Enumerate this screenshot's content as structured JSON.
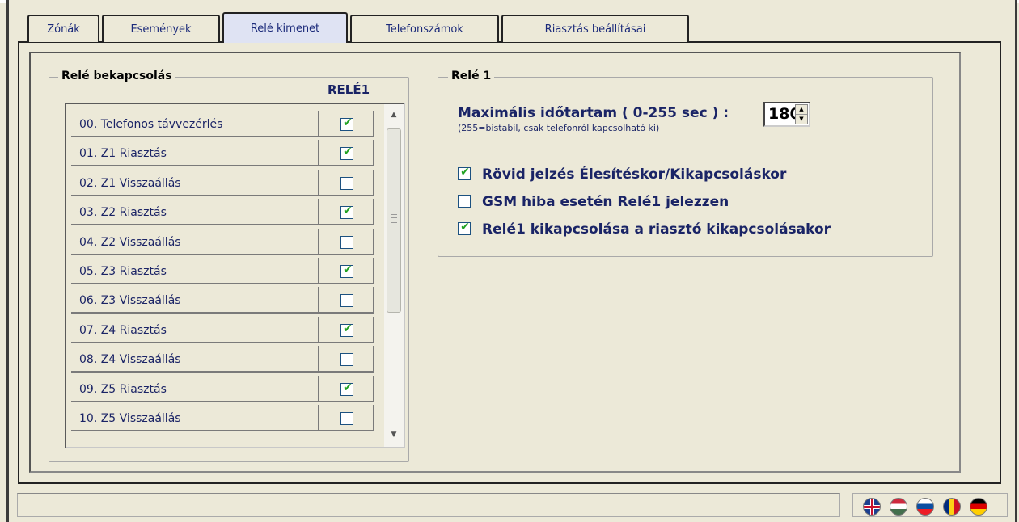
{
  "tabs": [
    {
      "label": "Zónák"
    },
    {
      "label": "Események"
    },
    {
      "label": "Relé kimenet"
    },
    {
      "label": "Telefonszámok"
    },
    {
      "label": "Riasztás beállításai"
    }
  ],
  "active_tab": "Relé kimenet",
  "relay_switch_group": {
    "title": "Relé bekapcsolás",
    "column_header": "RELÉ1",
    "rows": [
      {
        "label": "00. Telefonos távvezérlés",
        "checked": true
      },
      {
        "label": "01. Z1 Riasztás",
        "checked": true
      },
      {
        "label": "02. Z1 Visszaállás",
        "checked": false
      },
      {
        "label": "03. Z2 Riasztás",
        "checked": true
      },
      {
        "label": "04. Z2 Visszaállás",
        "checked": false
      },
      {
        "label": "05. Z3 Riasztás",
        "checked": true
      },
      {
        "label": "06. Z3 Visszaállás",
        "checked": false
      },
      {
        "label": "07. Z4 Riasztás",
        "checked": true
      },
      {
        "label": "08. Z4 Visszaállás",
        "checked": false
      },
      {
        "label": "09. Z5 Riasztás",
        "checked": true
      },
      {
        "label": "10. Z5 Visszaállás",
        "checked": false
      }
    ]
  },
  "relay1_group": {
    "title": "Relé 1",
    "max_duration_label": "Maximális időtartam ( 0-255 sec ) :",
    "max_duration_hint": "(255=bistabil, csak telefonról kapcsolható ki)",
    "max_duration_value": "180",
    "options": [
      {
        "label": "Rövid jelzés Élesítéskor/Kikapcsoláskor",
        "checked": true
      },
      {
        "label": "GSM hiba esetén Relé1 jelezzen",
        "checked": false
      },
      {
        "label": "Relé1 kikapcsolása a riasztó kikapcsolásakor",
        "checked": true
      }
    ]
  },
  "languages": [
    {
      "icon": "uk-flag-icon"
    },
    {
      "icon": "hungary-flag-icon"
    },
    {
      "icon": "slovakia-flag-icon"
    },
    {
      "icon": "romania-flag-icon"
    },
    {
      "icon": "germany-flag-icon"
    }
  ],
  "colors": {
    "check": "#21a121",
    "label_blue": "#1a2466",
    "background": "#ece9d8"
  }
}
